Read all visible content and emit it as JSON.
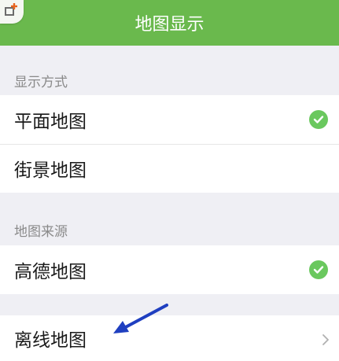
{
  "header": {
    "title": "地图显示",
    "icon": "map-pin-add-icon"
  },
  "display_mode": {
    "title": "显示方式",
    "items": [
      {
        "label": "平面地图",
        "selected": true
      },
      {
        "label": "街景地图",
        "selected": false
      }
    ]
  },
  "map_source": {
    "title": "地图来源",
    "items": [
      {
        "label": "高德地图",
        "selected": true
      }
    ]
  },
  "offline": {
    "label": "离线地图",
    "icon": "chevron-right-icon"
  },
  "annotation": {
    "icon": "blue-arrow-icon",
    "color": "#1f3fc0"
  },
  "colors": {
    "header": "#6ab94d",
    "check": "#6ac85e",
    "background": "#efeff4"
  }
}
